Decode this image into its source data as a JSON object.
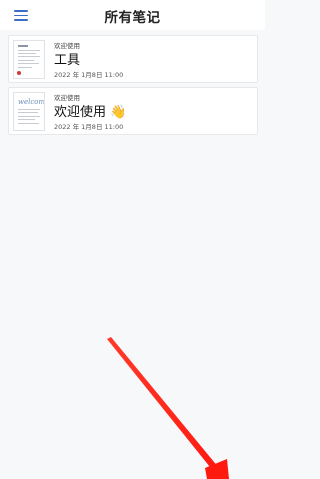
{
  "header": {
    "title": "所有笔记",
    "menu_icon": "hamburger-menu-icon"
  },
  "notes": [
    {
      "category": "欢迎使用",
      "title": "工具",
      "date": "2022 年 1月8日 11:00",
      "thumbnail": "document-page-preview"
    },
    {
      "category": "欢迎使用",
      "title": "欢迎使用 👋",
      "date": "2022 年 1月8日 11:00",
      "thumbnail": "welcome-page-preview",
      "thumbnail_text": "welcome"
    }
  ],
  "colors": {
    "accent": "#3b6cc8",
    "background": "#f7f8fa",
    "annotation_arrow": "#ff2a1f"
  }
}
